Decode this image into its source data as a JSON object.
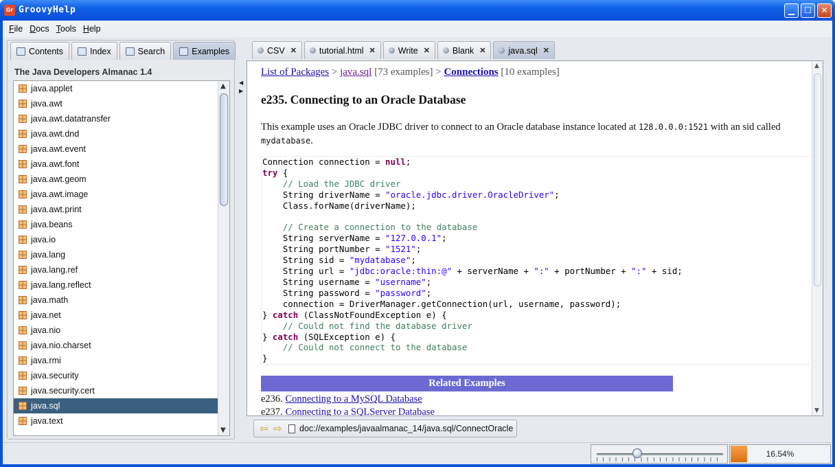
{
  "window": {
    "app_icon_text": "Gr",
    "title": "GroovyHelp"
  },
  "menu": [
    "File",
    "Docs",
    "Tools",
    "Help"
  ],
  "left_tabs": [
    "Contents",
    "Index",
    "Search",
    "Examples"
  ],
  "left_active_tab": 3,
  "almanac_title": "The Java Developers Almanac 1.4",
  "packages": [
    "java.applet",
    "java.awt",
    "java.awt.datatransfer",
    "java.awt.dnd",
    "java.awt.event",
    "java.awt.font",
    "java.awt.geom",
    "java.awt.image",
    "java.awt.print",
    "java.beans",
    "java.io",
    "java.lang",
    "java.lang.ref",
    "java.lang.reflect",
    "java.math",
    "java.net",
    "java.nio",
    "java.nio.charset",
    "java.rmi",
    "java.security",
    "java.security.cert",
    "java.sql",
    "java.text"
  ],
  "selected_package": "java.sql",
  "right_tabs": [
    "CSV",
    "tutorial.html",
    "Write",
    "Blank",
    "java.sql"
  ],
  "right_active_tab": 4,
  "doc": {
    "crumb_list": "List of Packages",
    "crumb_sep1": " > ",
    "crumb_pkg": "java.sql",
    "crumb_pkg_count": " [73 examples] > ",
    "crumb_topic": "Connections",
    "crumb_topic_count": " [10 examples]",
    "title": "e235. Connecting to an Oracle Database",
    "intro_a": "This example uses an Oracle JDBC driver to connect to an Oracle database instance located at ",
    "intro_host": "128.0.0.0:1521",
    "intro_b": " with an sid called ",
    "intro_sid": "mydatabase",
    "intro_c": ".",
    "code": [
      [
        [
          "",
          "Connection connection = "
        ],
        [
          "kw",
          "null"
        ],
        [
          "",
          ";"
        ]
      ],
      [
        [
          "kw",
          "try"
        ],
        [
          "",
          " {"
        ]
      ],
      [
        [
          "cm",
          "    // Load the JDBC driver"
        ]
      ],
      [
        [
          "",
          "    String driverName = "
        ],
        [
          "st",
          "\"oracle.jdbc.driver.OracleDriver\""
        ],
        [
          "",
          ";"
        ]
      ],
      [
        [
          "",
          "    Class.forName(driverName);"
        ]
      ],
      [
        [
          "",
          ""
        ]
      ],
      [
        [
          "cm",
          "    // Create a connection to the database"
        ]
      ],
      [
        [
          "",
          "    String serverName = "
        ],
        [
          "st",
          "\"127.0.0.1\""
        ],
        [
          "",
          ";"
        ]
      ],
      [
        [
          "",
          "    String portNumber = "
        ],
        [
          "st",
          "\"1521\""
        ],
        [
          "",
          ";"
        ]
      ],
      [
        [
          "",
          "    String sid = "
        ],
        [
          "st",
          "\"mydatabase\""
        ],
        [
          "",
          ";"
        ]
      ],
      [
        [
          "",
          "    String url = "
        ],
        [
          "st",
          "\"jdbc:oracle:thin:@\""
        ],
        [
          "",
          " + serverName + "
        ],
        [
          "st",
          "\":\""
        ],
        [
          "",
          " + portNumber + "
        ],
        [
          "st",
          "\":\""
        ],
        [
          "",
          " + sid;"
        ]
      ],
      [
        [
          "",
          "    String username = "
        ],
        [
          "st",
          "\"username\""
        ],
        [
          "",
          ";"
        ]
      ],
      [
        [
          "",
          "    String password = "
        ],
        [
          "st",
          "\"password\""
        ],
        [
          "",
          ";"
        ]
      ],
      [
        [
          "",
          "    connection = DriverManager.getConnection(url, username, password);"
        ]
      ],
      [
        [
          "",
          "} "
        ],
        [
          "kw",
          "catch"
        ],
        [
          "",
          " (ClassNotFoundException e) {"
        ]
      ],
      [
        [
          "cm",
          "    // Could not find the database driver"
        ]
      ],
      [
        [
          "",
          "} "
        ],
        [
          "kw",
          "catch"
        ],
        [
          "",
          " (SQLException e) {"
        ]
      ],
      [
        [
          "cm",
          "    // Could not connect to the database"
        ]
      ],
      [
        [
          "",
          "}"
        ]
      ]
    ],
    "related_header": "Related Examples",
    "related": [
      {
        "num": "e236. ",
        "title": "Connecting to a MySQL Database"
      },
      {
        "num": "e237. ",
        "title": "Connecting to a SQLServer Database"
      }
    ]
  },
  "address": "doc://examples/javaalmanac_14/java.sql/ConnectOracle",
  "zoom_percent": "16.54%",
  "progress_value": 16.54,
  "colors": {
    "titlebar": "#0a52d8",
    "selection": "#3b5f7f",
    "related_header": "#6a6ad2",
    "progress_fill": "#e5801e"
  }
}
